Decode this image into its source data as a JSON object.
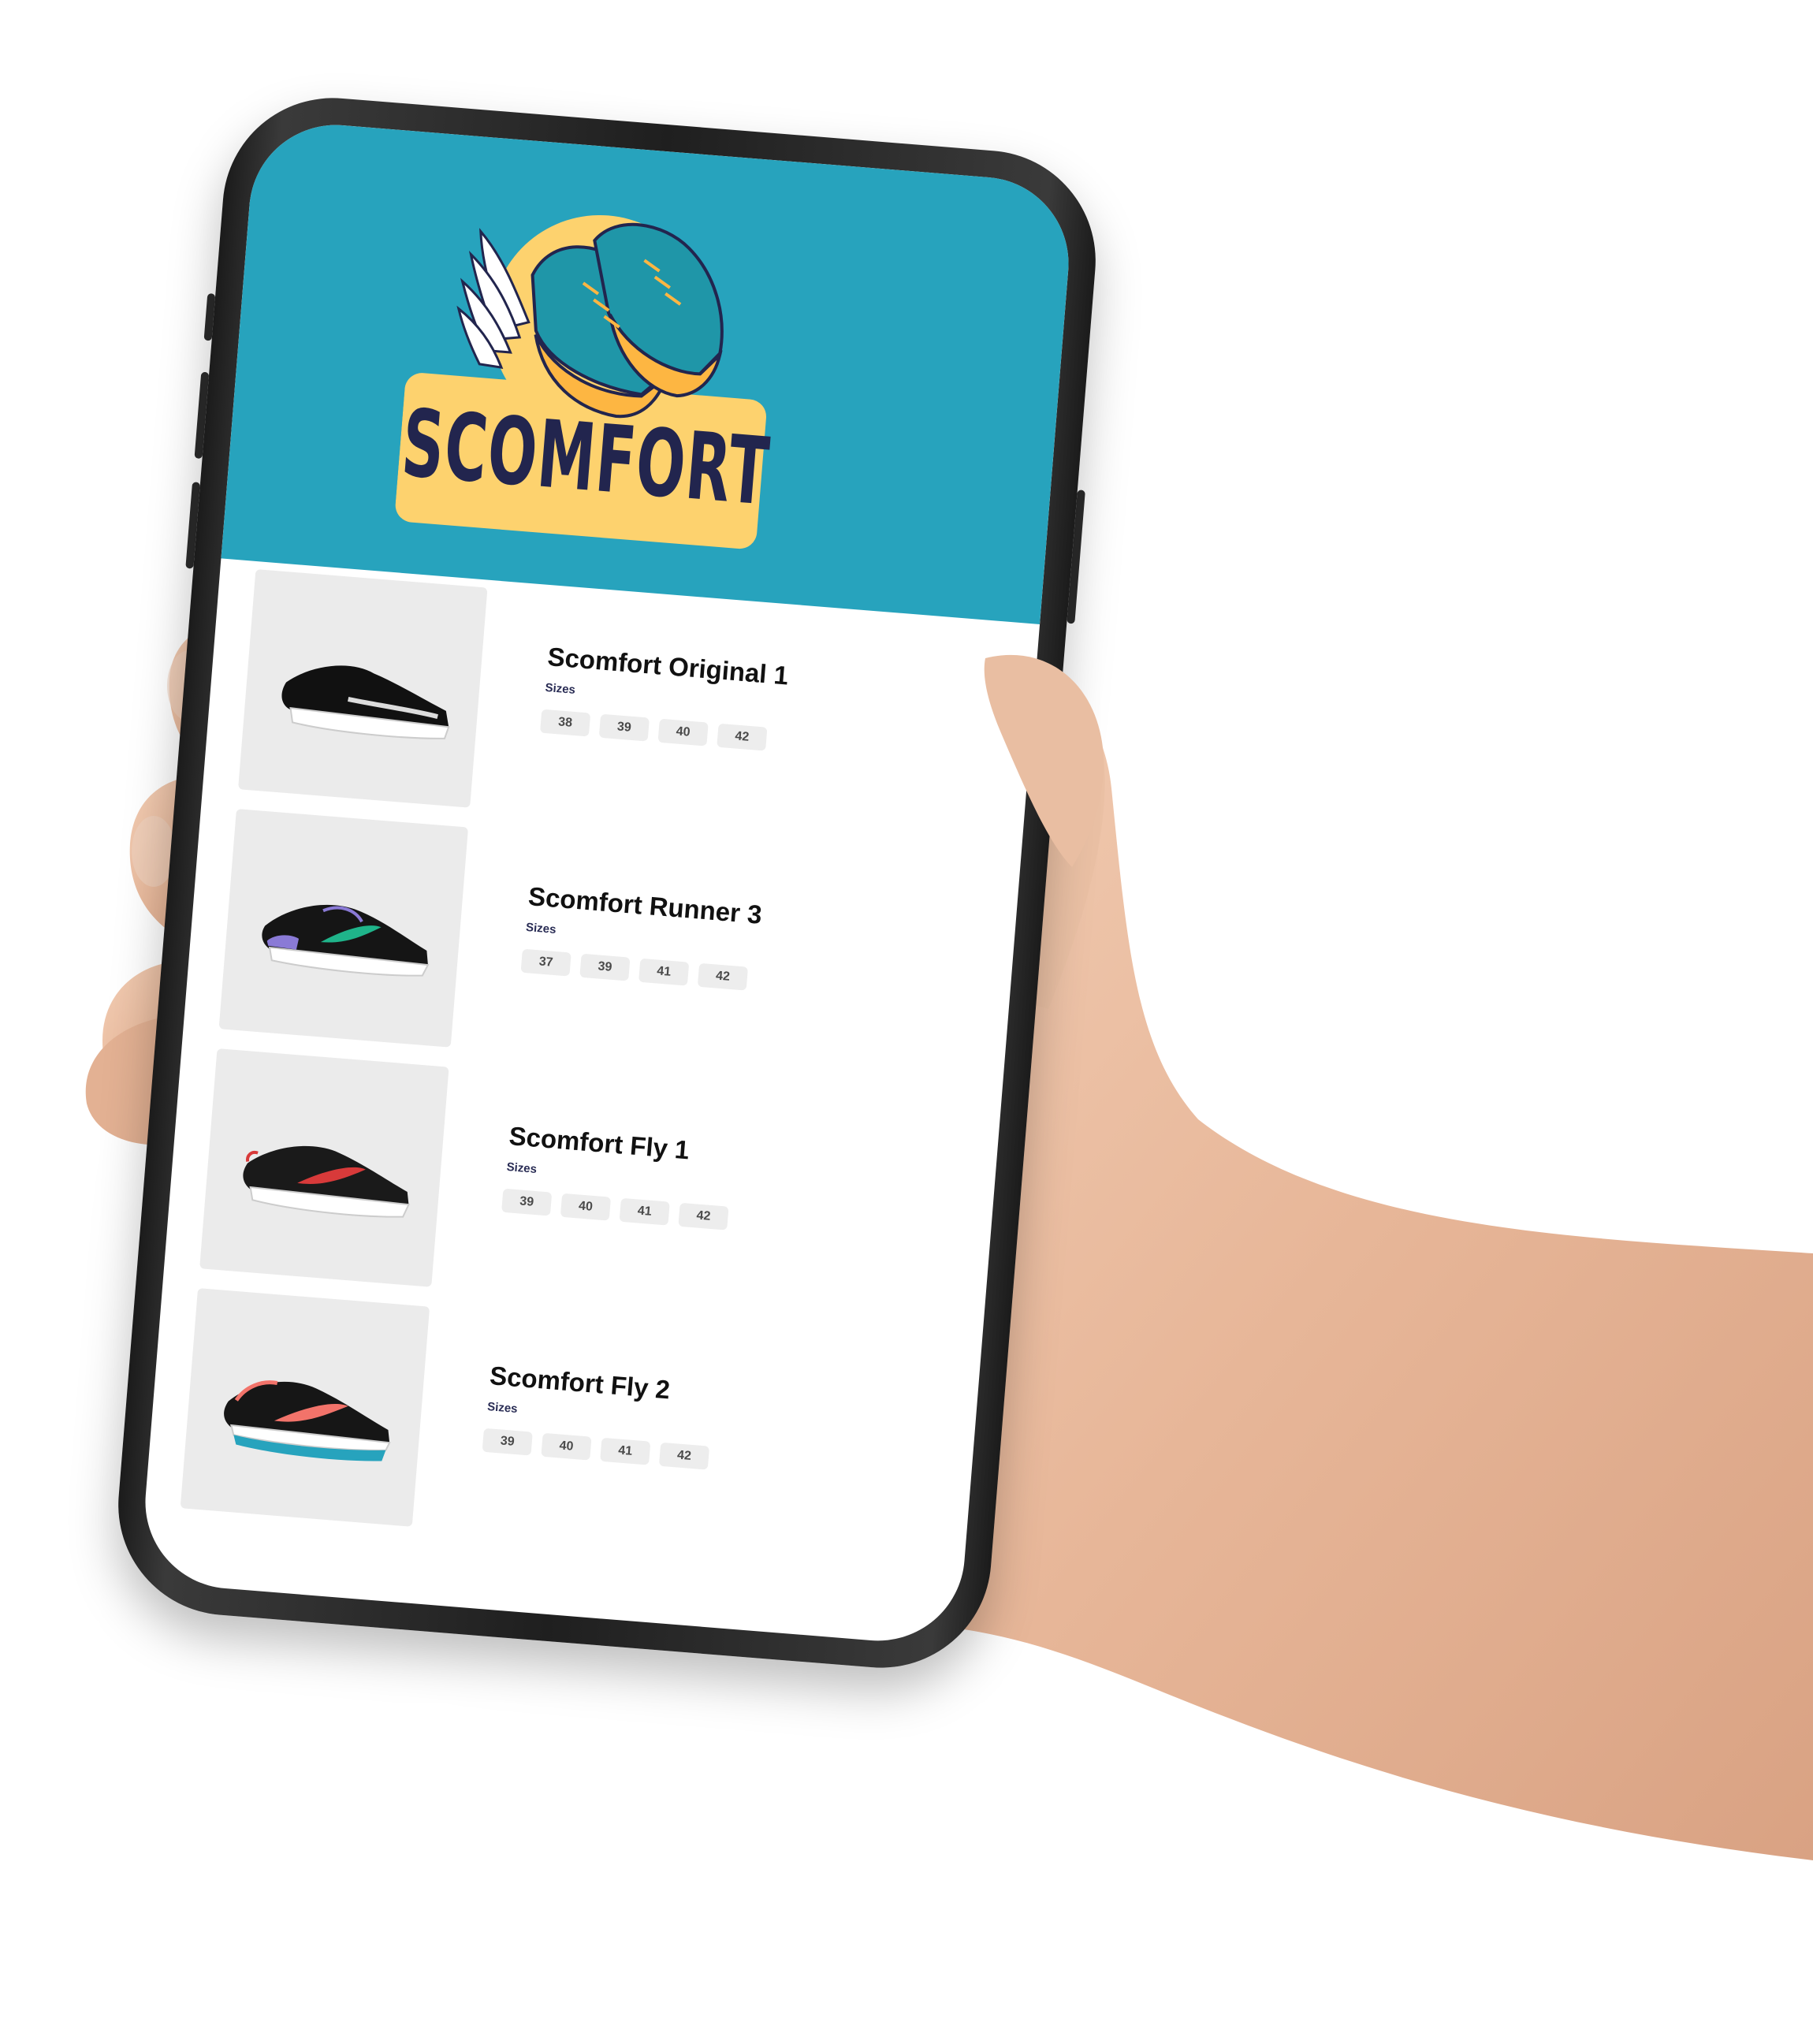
{
  "brand": {
    "name": "SCOMFORT",
    "colors": {
      "header": "#27a3bd",
      "logo_badge": "#fdd26e",
      "logo_text": "#22254e",
      "shoe": "#1f96a8"
    }
  },
  "products": [
    {
      "title": "Scomfort Original 1",
      "sizes_label": "Sizes",
      "sizes": [
        "38",
        "39",
        "40",
        "42"
      ],
      "image": "black-running-shoe-icon"
    },
    {
      "title": "Scomfort Runner 3",
      "sizes_label": "Sizes",
      "sizes": [
        "37",
        "39",
        "41",
        "42"
      ],
      "image": "black-shoe-green-swoosh-icon"
    },
    {
      "title": "Scomfort Fly 1",
      "sizes_label": "Sizes",
      "sizes": [
        "39",
        "40",
        "41",
        "42"
      ],
      "image": "black-shoe-red-swoosh-icon"
    },
    {
      "title": "Scomfort Fly 2",
      "sizes_label": "Sizes",
      "sizes": [
        "39",
        "40",
        "41",
        "42"
      ],
      "image": "black-shoe-coral-swoosh-icon"
    }
  ]
}
